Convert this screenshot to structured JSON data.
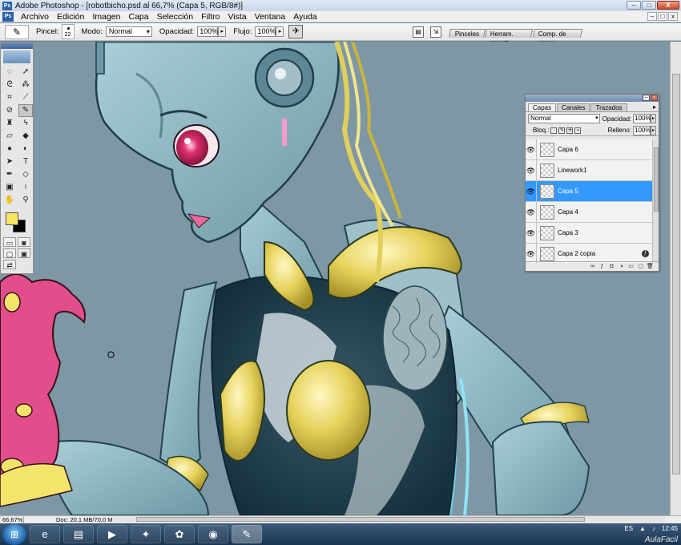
{
  "window": {
    "title": "Adobe Photoshop - [robotbicho.psd al 66,7% (Capa 5, RGB/8#)]",
    "logo": "Ps",
    "controls": [
      "–",
      "□",
      "X"
    ]
  },
  "menubar": {
    "logo": "Ps",
    "items": [
      "Archivo",
      "Edición",
      "Imagen",
      "Capa",
      "Selección",
      "Filtro",
      "Vista",
      "Ventana",
      "Ayuda"
    ],
    "doc_controls": [
      "–",
      "□",
      "x"
    ]
  },
  "options": {
    "brush_label": "Pincel:",
    "brush_size": "22",
    "mode_label": "Modo:",
    "mode_value": "Normal",
    "opacity_label": "Opacidad:",
    "opacity_value": "100%",
    "flow_label": "Flujo:",
    "flow_value": "100%",
    "well_tabs": [
      "Pinceles",
      "Herram. preest.",
      "Comp. de capas"
    ]
  },
  "tools": {
    "icons": [
      "move-icon",
      "marquee-icon",
      "lasso-icon",
      "magic-wand-icon",
      "crop-icon",
      "slice-icon",
      "healing-icon",
      "brush-icon",
      "stamp-icon",
      "history-brush-icon",
      "eraser-icon",
      "bucket-icon",
      "blur-icon",
      "dodge-icon",
      "path-select-icon",
      "type-icon",
      "pen-icon",
      "shape-icon",
      "notes-icon",
      "eyedropper-icon",
      "hand-icon",
      "zoom-icon"
    ],
    "foreground_color": "#f4e563",
    "background_color": "#000000"
  },
  "layers_panel": {
    "tabs": [
      "Capas",
      "Canales",
      "Trazados"
    ],
    "blend_mode": "Normal",
    "opacity_label": "Opacidad:",
    "opacity_value": "100%",
    "lock_label": "Bloq.:",
    "fill_label": "Relleno:",
    "fill_value": "100%",
    "layers": [
      {
        "name": "Capa 6",
        "selected": false
      },
      {
        "name": "Linework1",
        "selected": false
      },
      {
        "name": "Capa 5",
        "selected": true
      },
      {
        "name": "Capa 4",
        "selected": false
      },
      {
        "name": "Capa 3",
        "selected": false
      },
      {
        "name": "Capa 2 copia",
        "selected": false
      }
    ]
  },
  "status": {
    "zoom": "66,67%",
    "doc_info": "Doc: 20,1 MB/70,0 MB"
  },
  "taskbar": {
    "language": "ES",
    "time": "12:45",
    "brand": "AulaFacil"
  },
  "colors": {
    "canvas_bg": "#7e97a5",
    "robot_skin": "#8fb6c2",
    "gold": "#e0cf5a",
    "pink_creature": "#e24e8b",
    "layer_selected": "#3399ff"
  }
}
